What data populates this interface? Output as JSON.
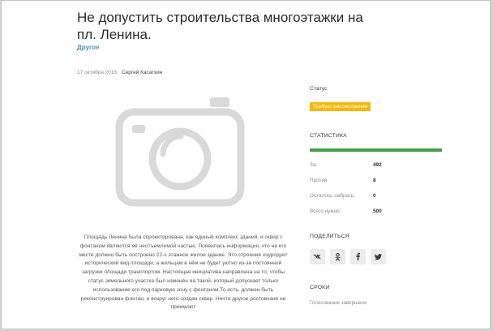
{
  "article": {
    "title": "Не допустить строительства многоэтажки на пл. Ленина.",
    "category": "Другое",
    "date": "17 октября 2016",
    "author": "Сергей Касаткин",
    "body": "Площадь Ленина была спроектирована, как единый комплекс зданий, и сквер с фонтаном являются её неотъемлемой частью. Появилась информация, что на его месте должно быть построено 22-х этажное жилое здание. Это строение изуродует исторический вид площади, а жильцам в нём не будет уютно из-за постоянной загрузки площади транспортом. Настоящая инициатива направлена на то, чтобы статус земельного участка был изменён на такой, который допускает только использование его под парковую зону с фонтаном.То есть, должен быть реконструирован фонтан, и вокруг него создан сквер. Ничто другое ростовчане не приемлют"
  },
  "sidebar": {
    "status_label": "Статус",
    "status_value": "Требует рассмотрения",
    "statistics_heading": "СТАТИСТИКА",
    "progress_fraction": 1.0,
    "stats": [
      {
        "label": "За:",
        "value": "492"
      },
      {
        "label": "Против:",
        "value": "8"
      },
      {
        "label": "Осталось набрать:",
        "value": "0"
      },
      {
        "label": "Всего нужно:",
        "value": "500"
      }
    ],
    "share_heading": "ПОДЕЛИТЬСЯ",
    "share_buttons": [
      {
        "name": "vk-icon",
        "glyph": "VK"
      },
      {
        "name": "odnoklassniki-icon",
        "glyph": "OK"
      },
      {
        "name": "facebook-icon",
        "glyph": "f"
      },
      {
        "name": "twitter-icon",
        "glyph": "t"
      }
    ],
    "deadline_heading": "СРОКИ",
    "deadline_text": "Голосование завершено"
  },
  "colors": {
    "accent_link": "#4a90c8",
    "status_badge": "#f2b80b",
    "progress": "#43a047",
    "icon": "#3b3b3b"
  }
}
